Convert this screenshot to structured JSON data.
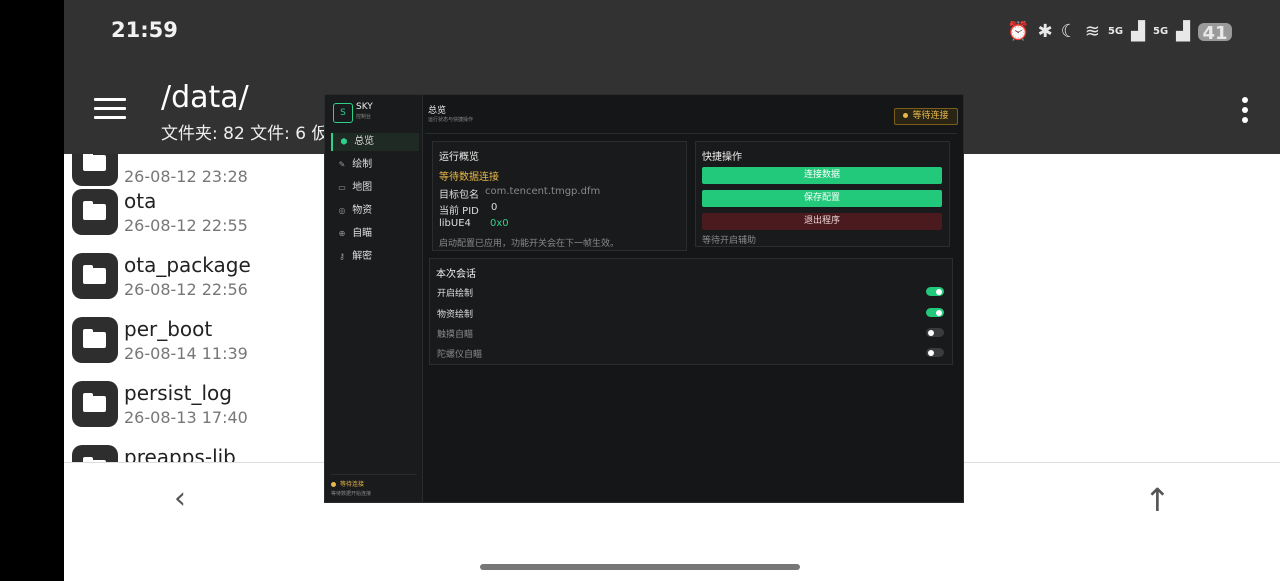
{
  "status": {
    "time": "21:59",
    "battery": "41",
    "net1": "5G",
    "net2": "5G"
  },
  "appbar": {
    "path": "/data/",
    "counts": "文件夹: 82  文件: 6  仮"
  },
  "files": [
    {
      "name": "",
      "date": "26-08-12 23:28"
    },
    {
      "name": "ota",
      "date": "26-08-12 22:55"
    },
    {
      "name": "ota_package",
      "date": "26-08-12 22:56"
    },
    {
      "name": "per_boot",
      "date": "26-08-14 11:39"
    },
    {
      "name": "persist_log",
      "date": "26-08-13 17:40"
    },
    {
      "name": "preapps-lib",
      "date": ""
    }
  ],
  "overlay": {
    "logo": "S",
    "brand": "SKY",
    "brand_sub": "控制台",
    "menu": [
      "总览",
      "绘制",
      "地图",
      "物资",
      "自瞄",
      "解密"
    ],
    "side_status": "等待连接",
    "side_status_sub": "等待数据开始连接",
    "header_title": "总览",
    "header_sub": "运行状态与快捷操作",
    "badge": "等待连接",
    "overview": {
      "title": "运行概览",
      "status": "等待数据连接",
      "pkg_label": "目标包名",
      "pkg_value": "com.tencent.tmgp.dfm",
      "pid_label": "当前 PID",
      "pid_value": "0",
      "ue4_label": "libUE4",
      "ue4_value": "0x0",
      "note": "启动配置已应用，功能开关会在下一帧生效。"
    },
    "quick": {
      "title": "快捷操作",
      "connect": "连接数据",
      "save": "保存配置",
      "exit": "退出程序",
      "note": "等待开启辅助"
    },
    "session": {
      "title": "本次会话",
      "items": [
        {
          "label": "开启绘制",
          "on": true
        },
        {
          "label": "物资绘制",
          "on": true
        },
        {
          "label": "触摸自瞄",
          "on": false
        },
        {
          "label": "陀螺仪自瞄",
          "on": false
        }
      ]
    }
  },
  "colors": {
    "accent": "#22c97a",
    "warn": "#e6b84a",
    "danger": "#4a1a1e"
  }
}
